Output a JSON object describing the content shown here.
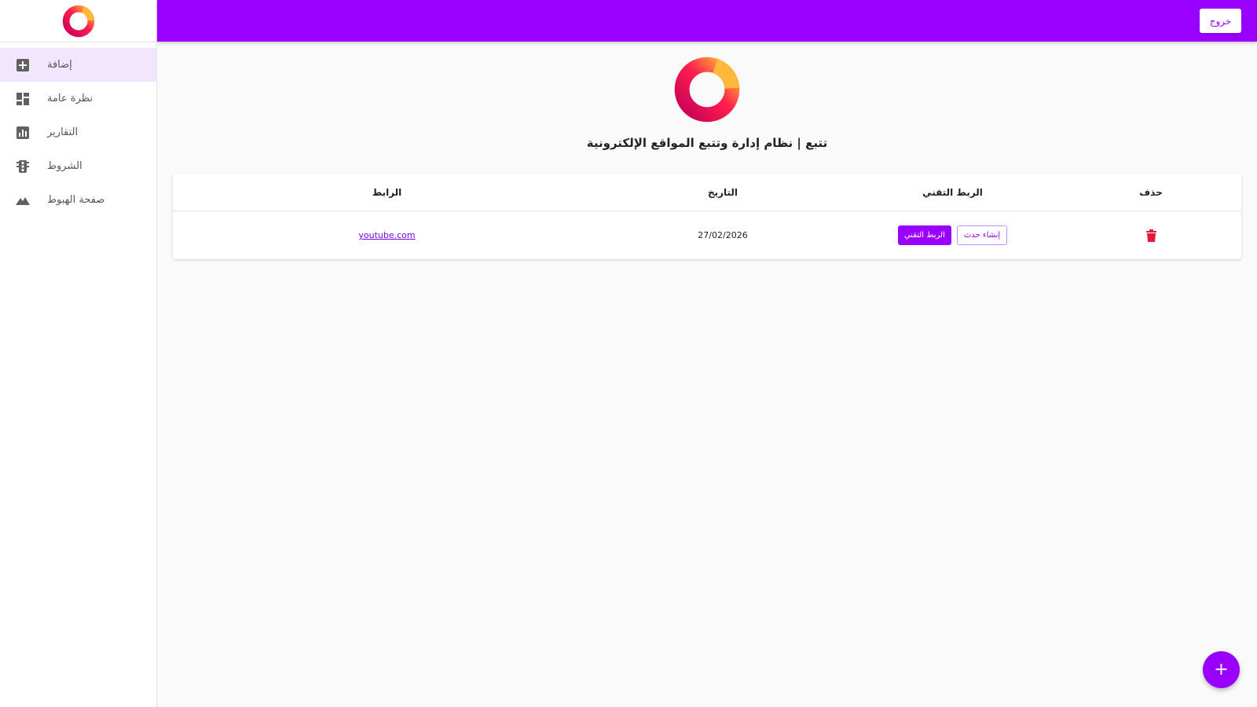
{
  "app": {
    "logo_icon": "brand-ring-logo",
    "accent_color": "#9900ff",
    "delete_color": "#e01b3c"
  },
  "topbar": {
    "logout_label": "خروج"
  },
  "sidebar": {
    "items": [
      {
        "label": "إضافة",
        "icon": "add-box-icon",
        "active": true
      },
      {
        "label": "نظرة عامة",
        "icon": "dashboard-icon",
        "active": false
      },
      {
        "label": "التقارير",
        "icon": "bar-chart-icon",
        "active": false
      },
      {
        "label": "الشروط",
        "icon": "traffic-light-icon",
        "active": false
      },
      {
        "label": "صفحة الهبوط",
        "icon": "landscape-icon",
        "active": false
      }
    ]
  },
  "main": {
    "title": "تتبع | نظام إدارة وتتبع المواقع الإلكترونية",
    "table": {
      "headers": {
        "link": "الرابط",
        "date": "التاريخ",
        "tech": "الربط التقني",
        "delete": "حذف"
      },
      "rows": [
        {
          "link": "youtube.com",
          "date": "27/02/2026",
          "tech_button": "الربط التقني",
          "event_button": "إنشاء حدث",
          "delete_icon": "trash-icon"
        }
      ]
    }
  },
  "fab": {
    "label": "+"
  }
}
